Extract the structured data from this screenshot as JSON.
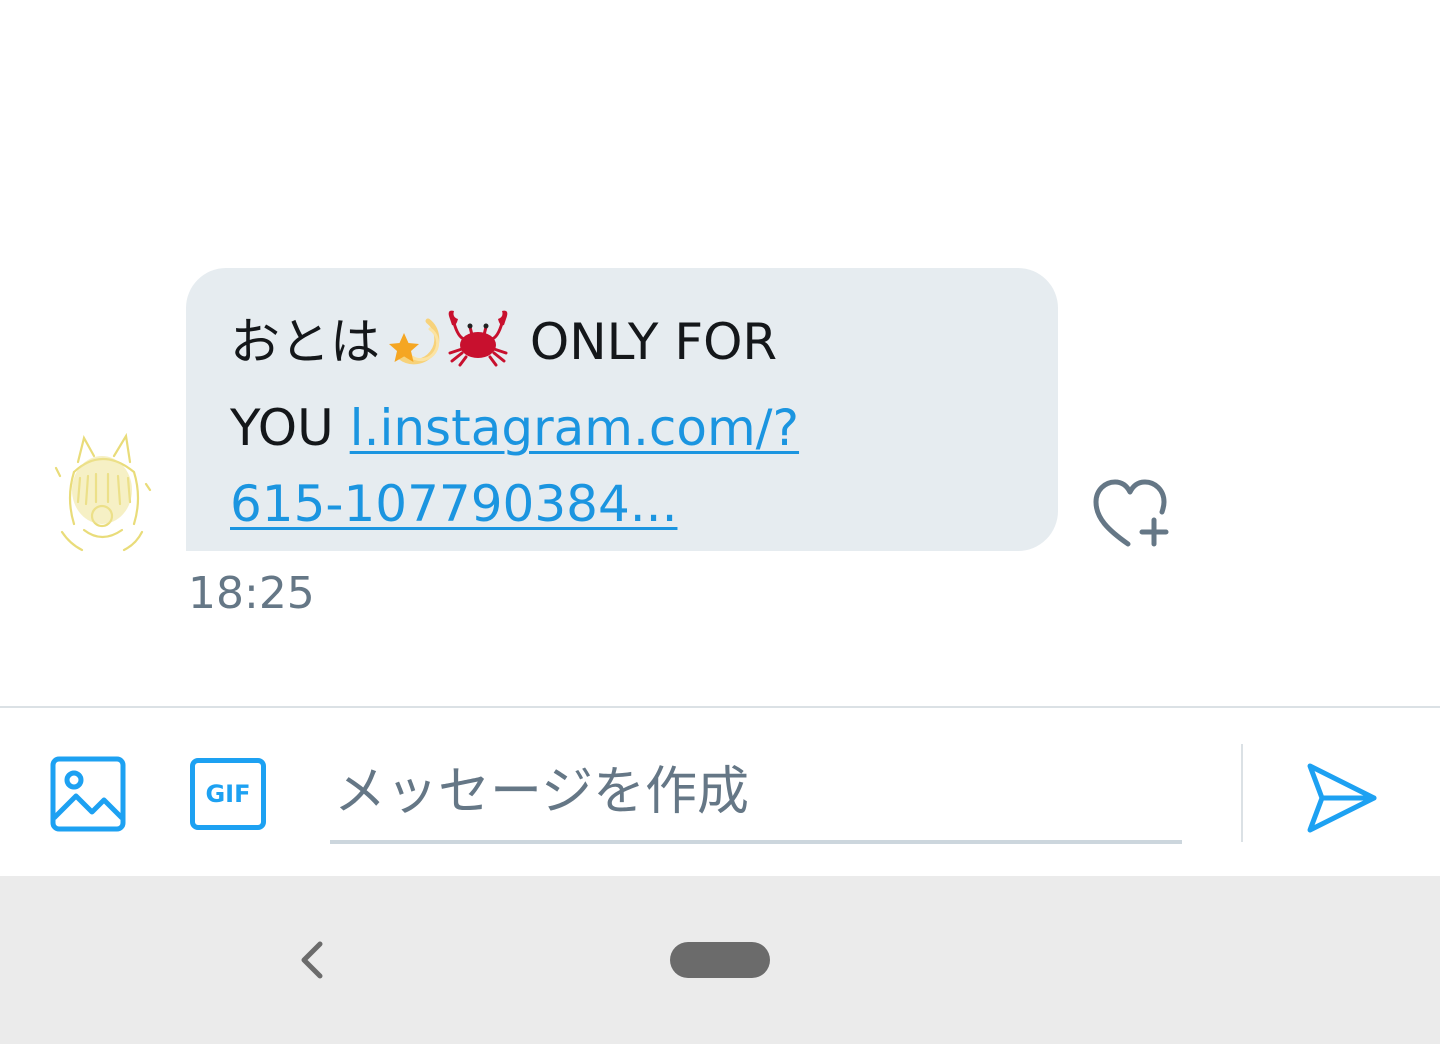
{
  "conversation": {
    "message": {
      "text_line1": "おとは",
      "emojis": [
        "dizzy-star-emoji",
        "crab-emoji"
      ],
      "text_line1_suffix": "ONLY FOR",
      "text_line2_prefix": "YOU",
      "link_part1": "l.instagram.com/?",
      "link_part2": "615-107790384...",
      "timestamp": "18:25",
      "sender_avatar": "avatar-image",
      "like_icon": "heart-plus-icon"
    }
  },
  "composer": {
    "media_icon": "image-icon",
    "gif_label": "GIF",
    "placeholder": "メッセージを作成",
    "value": "",
    "send_icon": "send-icon"
  },
  "navbar": {
    "back_icon": "chevron-left-icon",
    "home_icon": "home-pill-icon"
  },
  "colors": {
    "accent": "#1da1f2",
    "link": "#1b95e0",
    "bubble_bg": "#e6ecf0",
    "muted_text": "#657786",
    "navbar_bg": "#ebebeb"
  }
}
